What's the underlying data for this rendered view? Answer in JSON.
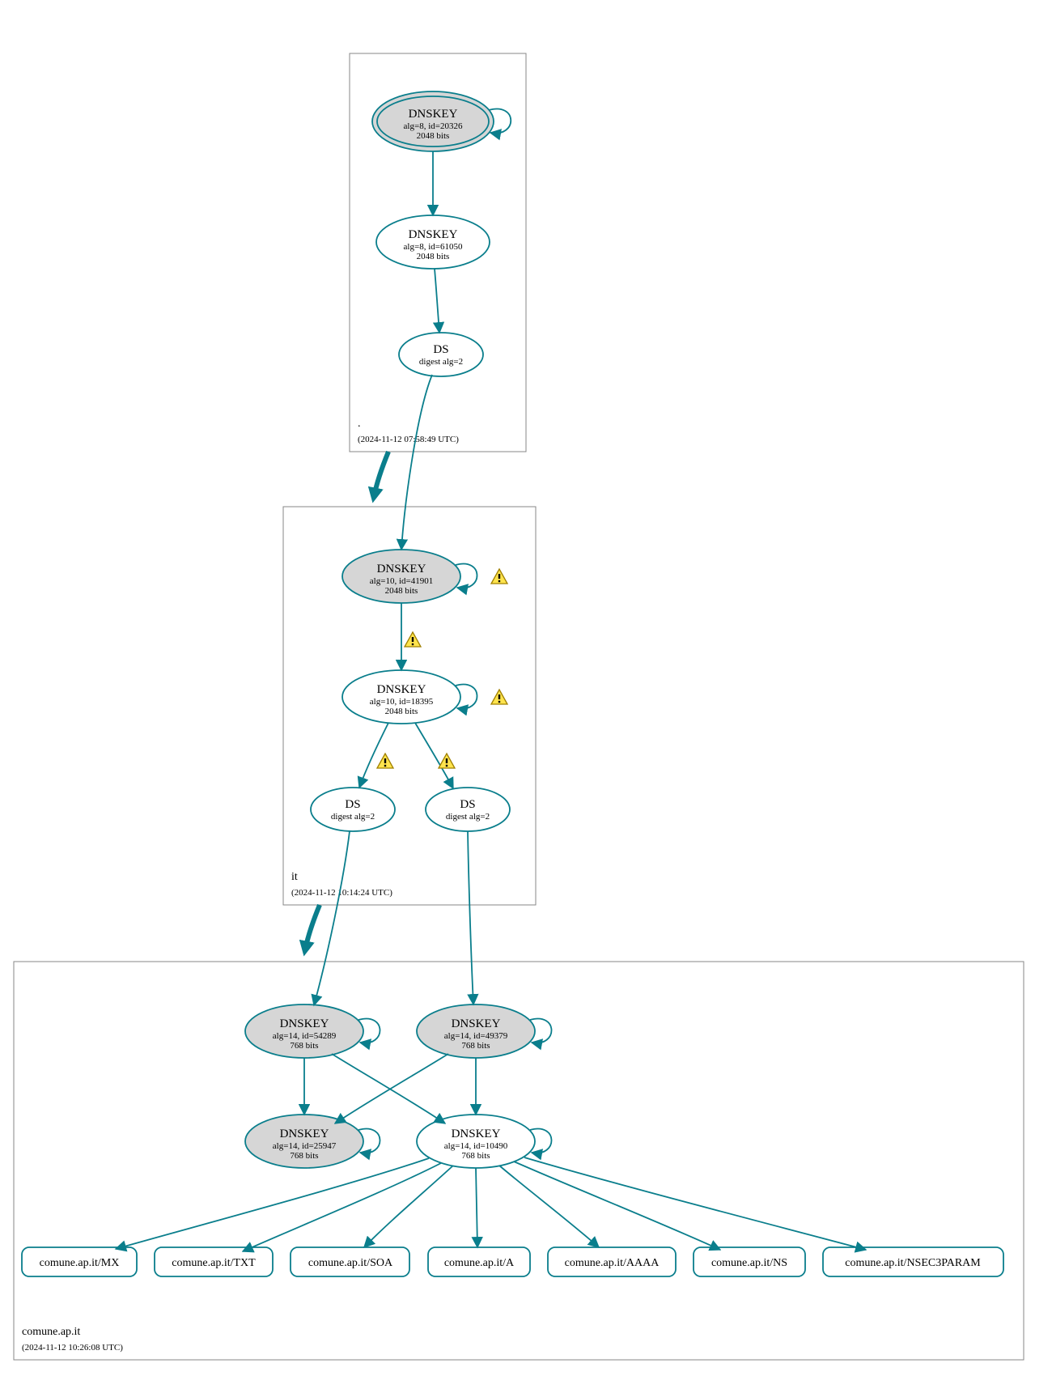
{
  "zones": {
    "root": {
      "label": ".",
      "timestamp": "(2024-11-12 07:58:49 UTC)"
    },
    "it": {
      "label": "it",
      "timestamp": "(2024-11-12 10:14:24 UTC)"
    },
    "leaf": {
      "label": "comune.ap.it",
      "timestamp": "(2024-11-12 10:26:08 UTC)"
    }
  },
  "nodes": {
    "root_ksk": {
      "title": "DNSKEY",
      "sub1": "alg=8, id=20326",
      "sub2": "2048 bits"
    },
    "root_zsk": {
      "title": "DNSKEY",
      "sub1": "alg=8, id=61050",
      "sub2": "2048 bits"
    },
    "root_ds": {
      "title": "DS",
      "sub1": "digest alg=2"
    },
    "it_ksk": {
      "title": "DNSKEY",
      "sub1": "alg=10, id=41901",
      "sub2": "2048 bits"
    },
    "it_zsk": {
      "title": "DNSKEY",
      "sub1": "alg=10, id=18395",
      "sub2": "2048 bits"
    },
    "it_ds1": {
      "title": "DS",
      "sub1": "digest alg=2"
    },
    "it_ds2": {
      "title": "DS",
      "sub1": "digest alg=2"
    },
    "leaf_k1": {
      "title": "DNSKEY",
      "sub1": "alg=14, id=54289",
      "sub2": "768 bits"
    },
    "leaf_k2": {
      "title": "DNSKEY",
      "sub1": "alg=14, id=49379",
      "sub2": "768 bits"
    },
    "leaf_k3": {
      "title": "DNSKEY",
      "sub1": "alg=14, id=25947",
      "sub2": "768 bits"
    },
    "leaf_k4": {
      "title": "DNSKEY",
      "sub1": "alg=14, id=10490",
      "sub2": "768 bits"
    }
  },
  "records": {
    "mx": "comune.ap.it/MX",
    "txt": "comune.ap.it/TXT",
    "soa": "comune.ap.it/SOA",
    "a": "comune.ap.it/A",
    "aaaa": "comune.ap.it/AAAA",
    "ns": "comune.ap.it/NS",
    "nsec": "comune.ap.it/NSEC3PARAM"
  }
}
